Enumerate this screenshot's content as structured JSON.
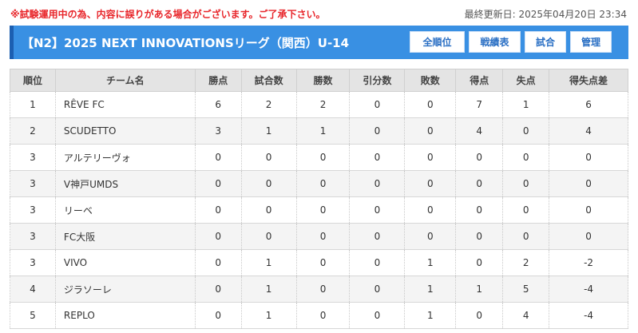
{
  "notice": "※試験運用中の為、内容に誤りがある場合がございます。ご了承下さい。",
  "updated": "最終更新日: 2025年04月20日 23:34",
  "header": {
    "title": "【N2】2025 NEXT INNOVATIONSリーグ（関西）U-14",
    "buttons": {
      "all_rank": "全順位",
      "record": "戦績表",
      "match": "試合",
      "manage": "管理"
    }
  },
  "table": {
    "columns": [
      "順位",
      "チーム名",
      "勝点",
      "試合数",
      "勝数",
      "引分数",
      "敗数",
      "得点",
      "失点",
      "得失点差"
    ],
    "rows": [
      [
        "1",
        "RÊVE FC",
        "6",
        "2",
        "2",
        "0",
        "0",
        "7",
        "1",
        "6"
      ],
      [
        "2",
        "SCUDETTO",
        "3",
        "1",
        "1",
        "0",
        "0",
        "4",
        "0",
        "4"
      ],
      [
        "3",
        "アルテリーヴォ",
        "0",
        "0",
        "0",
        "0",
        "0",
        "0",
        "0",
        "0"
      ],
      [
        "3",
        "V神戸UMDS",
        "0",
        "0",
        "0",
        "0",
        "0",
        "0",
        "0",
        "0"
      ],
      [
        "3",
        "リーベ",
        "0",
        "0",
        "0",
        "0",
        "0",
        "0",
        "0",
        "0"
      ],
      [
        "3",
        "FC大阪",
        "0",
        "0",
        "0",
        "0",
        "0",
        "0",
        "0",
        "0"
      ],
      [
        "3",
        "VIVO",
        "0",
        "1",
        "0",
        "0",
        "1",
        "0",
        "2",
        "-2"
      ],
      [
        "4",
        "ジラソーレ",
        "0",
        "1",
        "0",
        "0",
        "1",
        "1",
        "5",
        "-4"
      ],
      [
        "5",
        "REPLO",
        "0",
        "1",
        "0",
        "0",
        "1",
        "0",
        "4",
        "-4"
      ]
    ]
  }
}
